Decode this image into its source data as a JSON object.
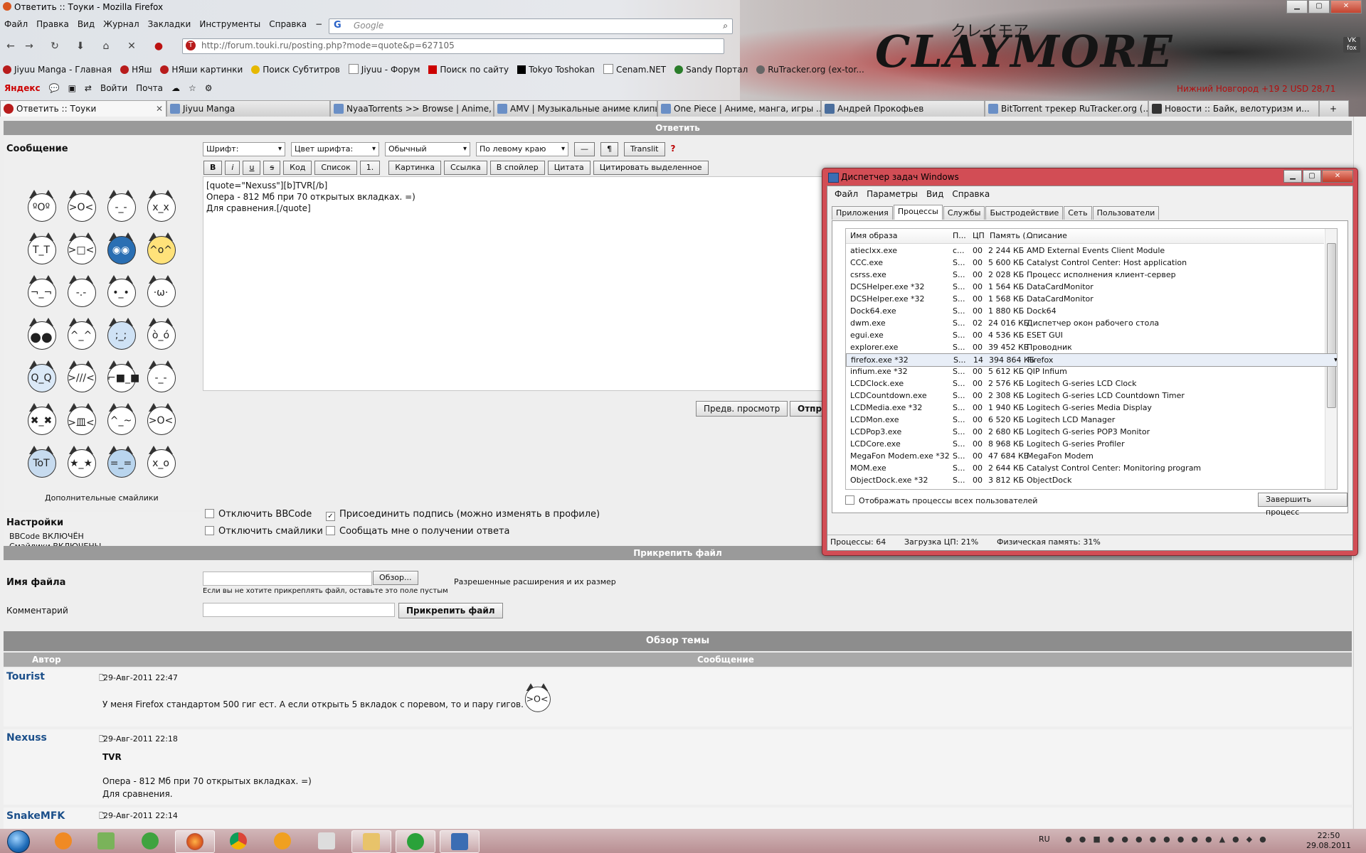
{
  "window": {
    "title": "Ответить :: Тоуки - Mozilla Firefox"
  },
  "menu": [
    "Файл",
    "Правка",
    "Вид",
    "Журнал",
    "Закладки",
    "Инструменты",
    "Справка"
  ],
  "search": {
    "placeholder": "Google"
  },
  "url": "http://forum.touki.ru/posting.php?mode=quote&p=627105",
  "bookmarks": [
    "Jiyuu Manga - Главная",
    "НЯш",
    "НЯши картинки",
    "Поиск Субтитров",
    "Jiyuu - Форум",
    "Поиск по сайту",
    "Tokyo Toshokan",
    "Cenam.NET",
    "Sandy Портал",
    "RuTracker.org (ex-tor..."
  ],
  "yandex_bar": {
    "logo": "Яндекс",
    "login": "Войти",
    "mail": "Почта"
  },
  "status_right": "Нижний Новгород  +19    2    USD 28,71",
  "banner": {
    "brand": "CLAYMORE",
    "brand_jp": "クレイモア"
  },
  "vk_label": "VK fox",
  "tabs": [
    {
      "label": "Ответить :: Тоуки",
      "active": true
    },
    {
      "label": "Jiyuu Manga",
      "active": false
    },
    {
      "label": "NyaaTorrents >> Browse | Anime, ...",
      "active": false
    },
    {
      "label": "AMV | Музыкальные аниме клипы",
      "active": false
    },
    {
      "label": "One Piece | Аниме, манга, игры ...",
      "active": false
    },
    {
      "label": "Андрей Прокофьев",
      "active": false
    },
    {
      "label": "BitTorrent трекер RuTracker.org (...",
      "active": false
    },
    {
      "label": "Новости :: Байк, велотуризм и...",
      "active": false
    }
  ],
  "page": {
    "reply_bar": "Ответить",
    "message_label": "Сообщение",
    "more_smileys": "Дополнительные смайлики",
    "toolbar": {
      "font": "Шрифт:",
      "color": "Цвет шрифта:",
      "size": "Обычный",
      "align": "По левому краю",
      "dash": "—",
      "para": "¶",
      "translit": "Translit",
      "help": "?"
    },
    "format_buttons": [
      "B",
      "i",
      "u",
      "s",
      "Код",
      "Список",
      "1.",
      "Картинка",
      "Ссылка",
      "В спойлер",
      "Цитата",
      "Цитировать выделенное"
    ],
    "editor_lines": [
      "[quote=\"Nexuss\"][b]TVR[/b]",
      "",
      "Опера - 812 Мб при 70 открытых вкладках. =)",
      "Для сравнения.[/quote]"
    ],
    "preview_button": "Предв. просмотр",
    "submit_button": "Отпр",
    "settings": {
      "title": "Настройки",
      "bbcode_line": "BBCode ВКЛЮЧЁН",
      "smileys_line": "Смайлики ВКЛЮЧЕНЫ",
      "opt_disable_bbcode": "Отключить BBCode",
      "opt_disable_smileys": "Отключить смайлики",
      "opt_attach_sig": "Присоединить подпись (можно изменять в профиле)",
      "opt_notify": "Сообщать мне о получении ответа"
    },
    "attach": {
      "bar": "Прикрепить файл",
      "filename_label": "Имя файла",
      "browse": "Обзор...",
      "allowed": "Разрешенные расширения и их размер",
      "hint": "Если вы не хотите прикреплять файл, оставьте это поле пустым",
      "comment_label": "Комментарий",
      "attach_button": "Прикрепить файл"
    },
    "review": {
      "bar": "Обзор темы",
      "col_author": "Автор",
      "col_message": "Сообщение"
    },
    "posts": [
      {
        "author": "Tourist",
        "time": "29-Авг-2011 22:47",
        "text": "У меня Firefox стандартом 500 гиг ест. А если открыть 5 вкладок с поревом, то и пару гигов."
      },
      {
        "author": "Nexuss",
        "time": "29-Авг-2011 22:18",
        "bold": "TVR",
        "line1": "Опера - 812 Мб при 70 открытых вкладках. =)",
        "line2": "Для сравнения."
      },
      {
        "author": "SnakeMFK",
        "time": "29-Авг-2011 22:14"
      }
    ]
  },
  "task_manager": {
    "title": "Диспетчер задач Windows",
    "menu": [
      "Файл",
      "Параметры",
      "Вид",
      "Справка"
    ],
    "tabs": [
      "Приложения",
      "Процессы",
      "Службы",
      "Быстродействие",
      "Сеть",
      "Пользователи"
    ],
    "active_tab": "Процессы",
    "columns": [
      "Имя образа",
      "П...",
      "ЦП",
      "Память (...",
      "Описание"
    ],
    "rows": [
      [
        "atieclxx.exe",
        "с...",
        "00",
        "2 244 КБ",
        "AMD External Events Client Module"
      ],
      [
        "CCC.exe",
        "S...",
        "00",
        "5 600 КБ",
        "Catalyst Control Center: Host application"
      ],
      [
        "csrss.exe",
        "S...",
        "00",
        "2 028 КБ",
        "Процесс исполнения клиент-сервер"
      ],
      [
        "DCSHelper.exe *32",
        "S...",
        "00",
        "1 564 КБ",
        "DataCardMonitor"
      ],
      [
        "DCSHelper.exe *32",
        "S...",
        "00",
        "1 568 КБ",
        "DataCardMonitor"
      ],
      [
        "Dock64.exe",
        "S...",
        "00",
        "1 880 КБ",
        "Dock64"
      ],
      [
        "dwm.exe",
        "S...",
        "02",
        "24 016 КБ",
        "Диспетчер окон рабочего стола"
      ],
      [
        "egui.exe",
        "S...",
        "00",
        "4 536 КБ",
        "ESET GUI"
      ],
      [
        "explorer.exe",
        "S...",
        "00",
        "39 452 КБ",
        "Проводник"
      ],
      [
        "firefox.exe *32",
        "S...",
        "14",
        "394 864 КБ",
        "Firefox"
      ],
      [
        "infium.exe *32",
        "S...",
        "00",
        "5 612 КБ",
        "QIP Infium"
      ],
      [
        "LCDClock.exe",
        "S...",
        "00",
        "2 576 КБ",
        "Logitech G-series LCD Clock"
      ],
      [
        "LCDCountdown.exe",
        "S...",
        "00",
        "2 308 КБ",
        "Logitech G-series LCD Countdown Timer"
      ],
      [
        "LCDMedia.exe *32",
        "S...",
        "00",
        "1 940 КБ",
        "Logitech G-series Media Display"
      ],
      [
        "LCDMon.exe",
        "S...",
        "00",
        "6 520 КБ",
        "Logitech LCD Manager"
      ],
      [
        "LCDPop3.exe",
        "S...",
        "00",
        "2 680 КБ",
        "Logitech G-series POP3 Monitor"
      ],
      [
        "LCDCore.exe",
        "S...",
        "00",
        "8 968 КБ",
        "Logitech G-series Profiler"
      ],
      [
        "MegaFon Modem.exe *32",
        "S...",
        "00",
        "47 684 КБ",
        "MegaFon Modem"
      ],
      [
        "MOM.exe",
        "S...",
        "00",
        "2 644 КБ",
        "Catalyst Control Center: Monitoring program"
      ],
      [
        "ObjectDock.exe *32",
        "S...",
        "00",
        "3 812 КБ",
        "ObjectDock"
      ]
    ],
    "selected_row": 9,
    "show_all": "Отображать процессы всех пользователей",
    "end_process": "Завершить процесс",
    "status_processes": "Процессы: 64",
    "status_cpu": "Загрузка ЦП: 21%",
    "status_mem": "Физическая память: 31%"
  },
  "taskbar": {
    "lang": "RU",
    "time": "22:50",
    "date": "29.08.2011",
    "icons": [
      "start-orb",
      "flashget",
      "usb-tool",
      "utorrent",
      "firefox",
      "chrome",
      "info",
      "calendar",
      "explorer",
      "podcast",
      "task-manager"
    ]
  }
}
